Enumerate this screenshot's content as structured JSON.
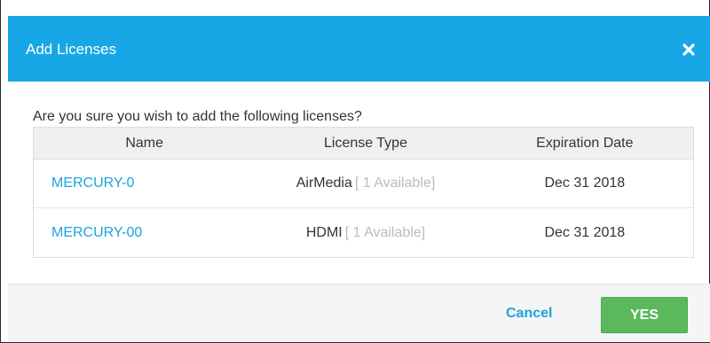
{
  "dialog": {
    "title": "Add Licenses",
    "close_icon": "close-icon",
    "prompt": "Are you sure you wish to add the following licenses?"
  },
  "table": {
    "headers": [
      "Name",
      "License Type",
      "Expiration Date"
    ],
    "rows": [
      {
        "name": "MERCURY-0",
        "type": "AirMedia",
        "available": "[ 1 Available]",
        "expiration": "Dec 31 2018"
      },
      {
        "name": "MERCURY-00",
        "type": "HDMI",
        "available": "[ 1 Available]",
        "expiration": "Dec 31 2018"
      }
    ]
  },
  "footer": {
    "cancel_label": "Cancel",
    "yes_label": "YES"
  },
  "colors": {
    "header": "#17a7e6",
    "link": "#1ba3dd",
    "yes_button": "#5cb85c",
    "available_text": "#bbbbbb"
  }
}
